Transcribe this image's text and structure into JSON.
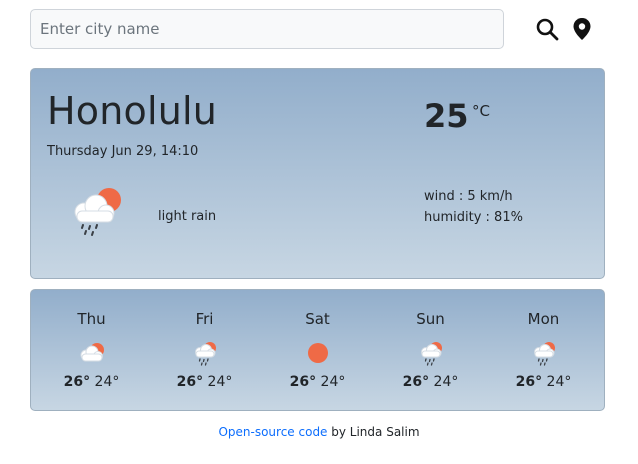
{
  "search": {
    "placeholder": "Enter city name"
  },
  "icons": {
    "search": "search-icon",
    "location": "map-pin-icon"
  },
  "current": {
    "city": "Honolulu",
    "date": "Thursday Jun 29, 14:10",
    "temperature": "25",
    "unit": "°C",
    "condition": "light rain",
    "icon": "rain-cloud-sun-icon",
    "wind": "wind : 5 km/h",
    "humidity": "humidity : 81%"
  },
  "forecast": [
    {
      "day": "Thu",
      "icon": "cloud-sun-icon",
      "high": "26°",
      "low": "24°"
    },
    {
      "day": "Fri",
      "icon": "rain-cloud-sun-icon",
      "high": "26°",
      "low": "24°"
    },
    {
      "day": "Sat",
      "icon": "sun-icon",
      "high": "26°",
      "low": "24°"
    },
    {
      "day": "Sun",
      "icon": "rain-cloud-sun-icon",
      "high": "26°",
      "low": "24°"
    },
    {
      "day": "Mon",
      "icon": "rain-cloud-sun-icon",
      "high": "26°",
      "low": "24°"
    }
  ],
  "footer": {
    "link_text": "Open-source code",
    "suffix": " by Linda Salim"
  },
  "colors": {
    "card_top": "#92aecb",
    "card_bottom": "#c7d6e3",
    "sun": "#ef6a46",
    "link": "#0d6efd"
  }
}
